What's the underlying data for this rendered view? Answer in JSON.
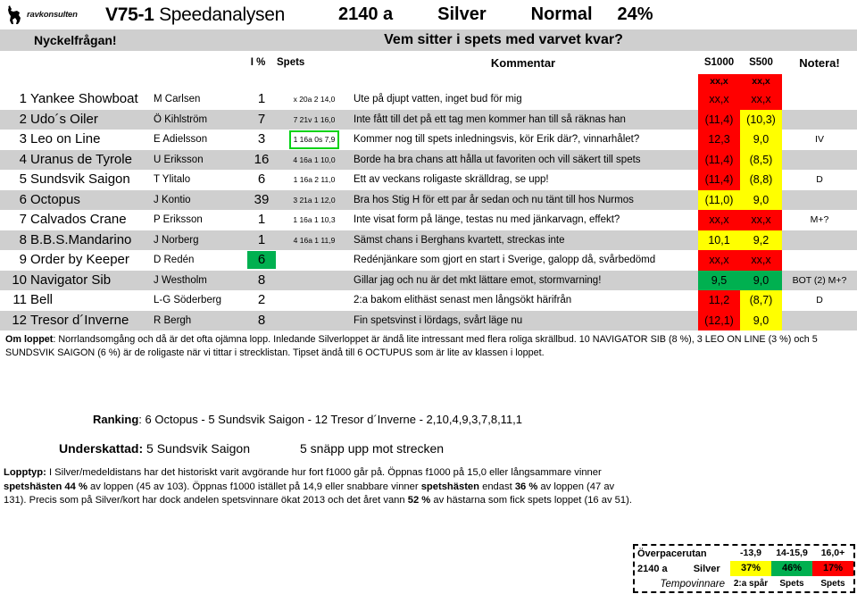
{
  "header": {
    "logo_text": "ravkonsulten",
    "race_id": "V75-1",
    "analysis_name": "Speedanalysen",
    "distance": "2140 a",
    "class": "Silver",
    "track_condition": "Normal",
    "percent": "24%"
  },
  "keyband": {
    "left_label": "Nyckelfrågan!",
    "question": "Vem sitter i spets med varvet kvar?"
  },
  "columns": {
    "pct": "I %",
    "spets": "Spets",
    "comment": "Kommentar",
    "s1000": "S1000",
    "s500": "S500",
    "notera": "Notera!"
  },
  "legend_row": {
    "s1000": "xx,x",
    "s500": "xx,x",
    "s1000_color": "#ff0000",
    "s500_color": "#ff0000"
  },
  "rows": [
    {
      "num": "1",
      "horse": "Yankee Showboat",
      "driver": "M Carlsen",
      "pct": "1",
      "pct_highlight": false,
      "spets": "x 20a 2 14,0",
      "spets_highlight": false,
      "comment": "Ute på djupt vatten, inget bud för mig",
      "s1000": "xx,x",
      "s1000_color": "#ff0000",
      "s500": "xx,x",
      "s500_color": "#ff0000",
      "notera": "",
      "shaded": false
    },
    {
      "num": "2",
      "horse": "Udo´s Oiler",
      "driver": "Ö Kihlström",
      "pct": "7",
      "pct_highlight": false,
      "spets": "7 21v 1 16,0",
      "spets_highlight": false,
      "comment": "Inte fått till det på ett tag men kommer han till så räknas han",
      "s1000": "(11,4)",
      "s1000_color": "#ff0000",
      "s500": "(10,3)",
      "s500_color": "#ffff00",
      "notera": "",
      "shaded": true
    },
    {
      "num": "3",
      "horse": "Leo on Line",
      "driver": "E Adielsson",
      "pct": "3",
      "pct_highlight": false,
      "spets": "1 16a 0s 7,9",
      "spets_highlight": true,
      "comment": "Kommer nog till spets inledningsvis, kör Erik där?, vinnarhålet?",
      "s1000": "12,3",
      "s1000_color": "#ff0000",
      "s500": "9,0",
      "s500_color": "#ffff00",
      "notera": "IV",
      "shaded": false
    },
    {
      "num": "4",
      "horse": "Uranus de Tyrole",
      "driver": "U Eriksson",
      "pct": "16",
      "pct_highlight": false,
      "spets": "4 16a 1 10,0",
      "spets_highlight": false,
      "comment": "Borde ha bra chans att hålla ut favoriten och vill säkert till spets",
      "s1000": "(11,4)",
      "s1000_color": "#ff0000",
      "s500": "(8,5)",
      "s500_color": "#ffff00",
      "notera": "",
      "shaded": true
    },
    {
      "num": "5",
      "horse": "Sundsvik Saigon",
      "driver": "T Ylitalo",
      "pct": "6",
      "pct_highlight": false,
      "spets": "1 16a 2 11,0",
      "spets_highlight": false,
      "comment": "Ett av veckans roligaste skrälldrag, se upp!",
      "s1000": "(11,4)",
      "s1000_color": "#ff0000",
      "s500": "(8,8)",
      "s500_color": "#ffff00",
      "notera": "D",
      "shaded": false
    },
    {
      "num": "6",
      "horse": "Octopus",
      "driver": "J Kontio",
      "pct": "39",
      "pct_highlight": false,
      "spets": "3 21a 1 12,0",
      "spets_highlight": false,
      "comment": "Bra hos Stig H för ett par år sedan och nu tänt till hos Nurmos",
      "s1000": "(11,0)",
      "s1000_color": "#ffff00",
      "s500": "9,0",
      "s500_color": "#ffff00",
      "notera": "",
      "shaded": true
    },
    {
      "num": "7",
      "horse": "Calvados Crane",
      "driver": "P Eriksson",
      "pct": "1",
      "pct_highlight": false,
      "spets": "1 16a 1 10,3",
      "spets_highlight": false,
      "comment": "Inte visat form på länge, testas nu med jänkarvagn, effekt?",
      "s1000": "xx,x",
      "s1000_color": "#ff0000",
      "s500": "xx,x",
      "s500_color": "#ff0000",
      "notera": "M+?",
      "shaded": false
    },
    {
      "num": "8",
      "horse": "B.B.S.Mandarino",
      "driver": "J Norberg",
      "pct": "1",
      "pct_highlight": false,
      "spets": "4 16a 1 11,9",
      "spets_highlight": false,
      "comment": "Sämst chans i Berghans kvartett, streckas inte",
      "s1000": "10,1",
      "s1000_color": "#ffff00",
      "s500": "9,2",
      "s500_color": "#ffff00",
      "notera": "",
      "shaded": true
    },
    {
      "num": "9",
      "horse": "Order by Keeper",
      "driver": "D Redén",
      "pct": "6",
      "pct_highlight": true,
      "spets": "",
      "spets_highlight": false,
      "comment": "Redénjänkare som gjort en start i Sverige, galopp då, svårbedömd",
      "s1000": "xx,x",
      "s1000_color": "#ff0000",
      "s500": "xx,x",
      "s500_color": "#ff0000",
      "notera": "",
      "shaded": false
    },
    {
      "num": "10",
      "horse": "Navigator Sib",
      "driver": "J Westholm",
      "pct": "8",
      "pct_highlight": false,
      "spets": "",
      "spets_highlight": false,
      "comment": "Gillar jag och nu är det mkt lättare emot, stormvarning!",
      "s1000": "9,5",
      "s1000_color": "#00b050",
      "s500": "9,0",
      "s500_color": "#00b050",
      "notera": "BOT (2) M+?",
      "shaded": true
    },
    {
      "num": "11",
      "horse": "Bell",
      "driver": "L-G Söderberg",
      "pct": "2",
      "pct_highlight": false,
      "spets": "",
      "spets_highlight": false,
      "comment": "2:a bakom elithäst senast men långsökt härifrån",
      "s1000": "11,2",
      "s1000_color": "#ff0000",
      "s500": "(8,7)",
      "s500_color": "#ffff00",
      "notera": "D",
      "shaded": false
    },
    {
      "num": "12",
      "horse": "Tresor d´Inverne",
      "driver": "R Bergh",
      "pct": "8",
      "pct_highlight": false,
      "spets": "",
      "spets_highlight": false,
      "comment": "Fin spetsvinst i lördags, svårt läge nu",
      "s1000": "(12,1)",
      "s1000_color": "#ff0000",
      "s500": "9,0",
      "s500_color": "#ffff00",
      "notera": "",
      "shaded": true
    }
  ],
  "about": {
    "label": "Om loppet",
    "text": ": Norrlandsomgång och då är det ofta ojämna lopp. Inledande Silverloppet är ändå lite intressant med flera roliga skrällbud. 10 NAVIGATOR SIB (8 %), 3 LEO ON LINE (3 %) och 5 SUNDSVIK SAIGON (6 %) är de roligaste när vi tittar i strecklistan. Tipset ändå till 6 OCTUPUS som är lite av klassen i loppet."
  },
  "ranking": {
    "label": "Ranking",
    "value": ": 6 Octopus - 5 Sundsvik Saigon - 12 Tresor d´Inverne - 2,10,4,9,3,7,8,11,1"
  },
  "underskattad": {
    "label": "Underskattad:",
    "value": "5 Sundsvik Saigon",
    "note": "5 snäpp upp mot strecken"
  },
  "lopptyp": {
    "label": "Lopptyp:",
    "p1": " I Silver/medeldistans har det historiskt varit avgörande hur fort f1000 går på. Öppnas f1000 på 15,0 eller långsammare vinner ",
    "b1": "spetshästen 44 %",
    "p2": " av loppen (45 av 103). Öppnas f1000 istället på 14,9 eller snabbare vinner ",
    "b2": "spetshästen",
    "p3": " endast ",
    "b3": "36 %",
    "p4": " av loppen (47 av 131). Precis som på Silver/kort har dock andelen spetsvinnare ökat 2013 och det året vann ",
    "b4": "52 %",
    "p5": " av hästarna som fick spets loppet (16 av 51)."
  },
  "overpace": {
    "title": "Överpacerutan",
    "range_1": "-13,9",
    "range_2": "14-15,9",
    "range_3": "16,0+",
    "distance": "2140 a",
    "class": "Silver",
    "pct_1": "37%",
    "pct_2": "46%",
    "pct_3": "17%",
    "pct_1_color": "#ffff00",
    "pct_2_color": "#00b050",
    "pct_3_color": "#ff0000",
    "winner_label": "Tempovinnare",
    "res_1": "2:a spår",
    "res_2": "Spets",
    "res_3": "Spets"
  }
}
